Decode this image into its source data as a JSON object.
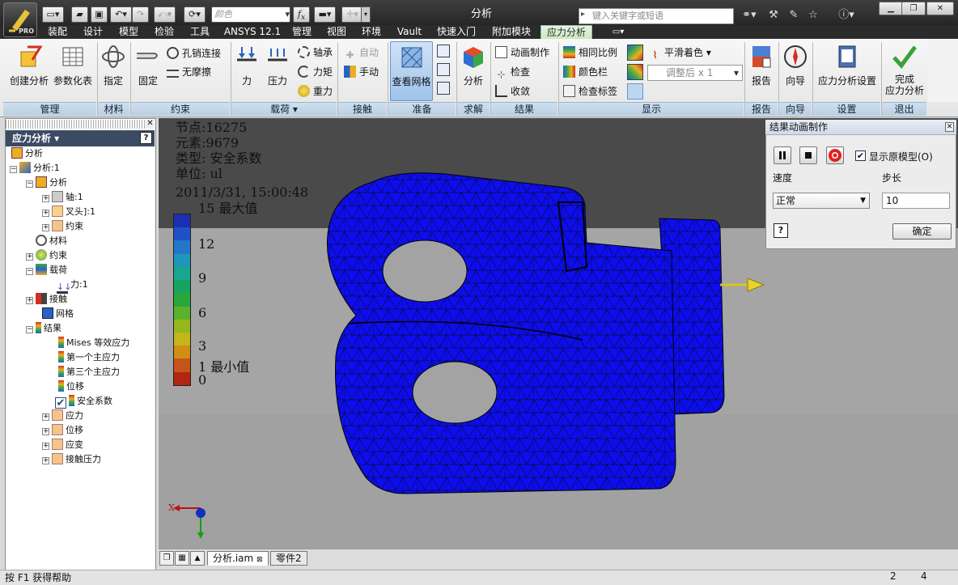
{
  "title": "分析",
  "search_placeholder": "键入关键字或短语",
  "qat": {
    "color_placeholder": "颜色"
  },
  "menus": [
    "装配",
    "设计",
    "模型",
    "检验",
    "工具",
    "ANSYS 12.1",
    "管理",
    "视图",
    "环境",
    "Vault",
    "快速入门",
    "附加模块",
    "应力分析"
  ],
  "ribbon": {
    "manage": {
      "caption": "管理",
      "create": "创建分析",
      "param": "参数化表"
    },
    "material": {
      "caption": "材料",
      "assign": "指定"
    },
    "constraints": {
      "caption": "约束",
      "fixed": "固定",
      "pin": "孔销连接",
      "frictionless": "无摩擦"
    },
    "loads": {
      "caption": "载荷 ▾",
      "force": "力",
      "pressure": "压力",
      "bearing": "轴承",
      "moment": "力矩",
      "gravity": "重力"
    },
    "contact": {
      "caption": "接触",
      "auto": "自动",
      "manual": "手动"
    },
    "prepare": {
      "caption": "准备",
      "mesh_view": "查看网格"
    },
    "solve": {
      "caption": "求解",
      "analyze": "分析"
    },
    "result": {
      "caption": "结果",
      "animate": "动画制作",
      "probe": "检查",
      "convergence": "收敛"
    },
    "display": {
      "caption": "显示",
      "same_scale": "相同比例",
      "colorbar": "颜色栏",
      "probe_labels": "检查标签",
      "smooth_shading": "平滑着色",
      "adjust": "调整后 x 1"
    },
    "report": {
      "caption": "报告",
      "report": "报告"
    },
    "guide": {
      "caption": "向导",
      "guide": "向导"
    },
    "settings": {
      "caption": "设置",
      "stress_settings": "应力分析设置"
    },
    "exit": {
      "caption": "退出",
      "finish_line1": "完成",
      "finish_line2": "应力分析"
    }
  },
  "browser": {
    "header": "应力分析 ▾",
    "items": [
      "分析",
      "分析:1",
      "分析",
      "轴:1",
      "叉头]:1",
      "约束",
      "材料",
      "约束",
      "载荷",
      "力:1",
      "接触",
      "网格",
      "结果",
      "Mises 等效应力",
      "第一个主应力",
      "第三个主应力",
      "位移",
      "安全系数",
      "应力",
      "位移",
      "应变",
      "接触压力"
    ]
  },
  "viewport": {
    "info": [
      "节点:16275",
      "元素:9679",
      "类型: 安全系数",
      "单位: ul",
      "2011/3/31, 15:00:48"
    ],
    "legend_max": "15 最大值",
    "legend_ticks": [
      "12",
      "9",
      "6",
      "3",
      "1 最小值",
      "0"
    ],
    "legend_colors": [
      "#1c2fb0",
      "#1f52c4",
      "#2377c9",
      "#1f97b8",
      "#17a68f",
      "#17a463",
      "#28a83b",
      "#5bb22a",
      "#94b81c",
      "#c3b51a",
      "#cf8f14",
      "#c6541a",
      "#b42412"
    ],
    "axis_label": "X"
  },
  "animation_dialog": {
    "title": "结果动画制作",
    "show_original": "显示原模型(O)",
    "speed_label": "速度",
    "step_label": "步长",
    "speed_value": "正常",
    "step_value": "10",
    "ok": "确定",
    "help": "?"
  },
  "doc_tabs": [
    "分析.iam",
    "零件2"
  ],
  "status": {
    "help": "按 F1 获得帮助",
    "num1": "2",
    "num2": "4"
  }
}
